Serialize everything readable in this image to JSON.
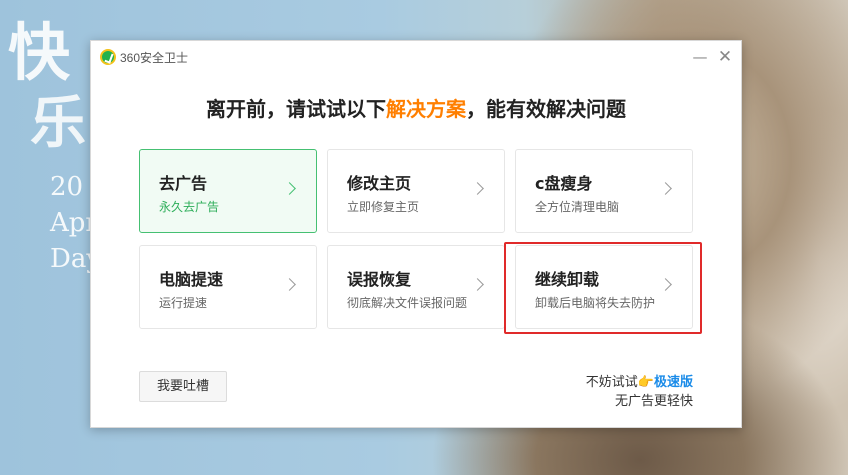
{
  "wallpaper": {
    "big1": "快",
    "big2": "乐",
    "line1": "20",
    "line2": "Apr",
    "line3": "Day"
  },
  "window": {
    "title": "360安全卫士",
    "minimize": "—",
    "close": "✕"
  },
  "headline": {
    "pre": "离开前，请试试以下",
    "highlight": "解决方案",
    "post": "，能有效解决问题"
  },
  "cards": [
    {
      "title": "去广告",
      "subtitle": "永久去广告"
    },
    {
      "title": "修改主页",
      "subtitle": "立即修复主页"
    },
    {
      "title": "c盘瘦身",
      "subtitle": "全方位清理电脑"
    },
    {
      "title": "电脑提速",
      "subtitle": "运行提速"
    },
    {
      "title": "误报恢复",
      "subtitle": "彻底解决文件误报问题"
    },
    {
      "title": "继续卸载",
      "subtitle": "卸载后电脑将失去防护"
    }
  ],
  "footer": {
    "feedback_label": "我要吐槽",
    "promo_prefix": "不妨试试",
    "promo_icon": "👉",
    "promo_link": "极速版",
    "promo_line2": "无广告更轻快"
  },
  "colors": {
    "accent_orange": "#ff7f00",
    "accent_green": "#45c072",
    "link_blue": "#1a8be8",
    "highlight_red": "#e02a2a"
  }
}
